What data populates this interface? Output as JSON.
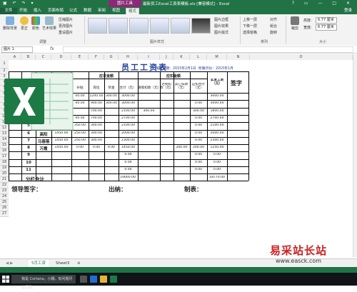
{
  "window": {
    "title": "最新员工Excel工资表模板.xls [兼容模式] - Excel",
    "context_tab": "图片工具",
    "controls": [
      "—",
      "□",
      "✕"
    ]
  },
  "tabs": {
    "file": "文件",
    "items": [
      "开始",
      "插入",
      "页面布局",
      "公式",
      "数据",
      "审阅",
      "视图",
      "格式"
    ],
    "active": "格式",
    "user": "登录"
  },
  "ribbon": {
    "remove_bg": "删除背景",
    "corrections": "更正",
    "color": "颜色",
    "artistic": "艺术效果",
    "compress": "压缩图片",
    "change_pic": "更改图片",
    "reset_pic": "重设图片",
    "group_adjust": "调整",
    "group_styles": "图片样式",
    "border": "图片边框",
    "effects": "图片效果",
    "layout": "图片版式",
    "forward": "上移一层",
    "backward": "下移一层",
    "selection": "选择窗格",
    "align": "对齐",
    "group": "组合",
    "rotate": "旋转",
    "group_arrange": "排列",
    "crop": "裁剪",
    "height_label": "高度:",
    "height_value": "6.77 厘米",
    "width_label": "宽度:",
    "width_value": "6.77 厘米",
    "group_size": "大小"
  },
  "formula_bar": {
    "name_box": "图片 1",
    "fx": "fx",
    "value": ""
  },
  "columns": [
    "A",
    "B",
    "C",
    "D",
    "E",
    "F",
    "G",
    "H",
    "I",
    "J",
    "K",
    "L",
    "M",
    "N",
    "O"
  ],
  "rows": [
    "1",
    "2",
    "3",
    "4",
    "5",
    "6",
    "7",
    "8",
    "9",
    "10",
    "11",
    "12",
    "13",
    "14",
    "15",
    "16",
    "17",
    "18",
    "19",
    "20",
    "21",
    "22",
    "23",
    "24",
    "25",
    "26",
    "27"
  ],
  "sheet": {
    "title": "员工工资表",
    "date_label": "发放日期：2015年2月1日",
    "period_label": "所属月份：2015年1月",
    "band_payable": "应发金额",
    "band_deduct": "应扣金额",
    "headers": {
      "subsidy": "补贴",
      "post": "岗位",
      "bonus": "奖金",
      "total": "合计（元）",
      "leave": "请假扣款（元）",
      "late": "迟到扣款（元）",
      "other": "其它扣款（元）",
      "deduct_total": "应扣合计（元）",
      "actual": "实发工资（元）",
      "sign": "签字"
    },
    "rows": [
      {
        "no": "",
        "name": "",
        "base": "",
        "subsidy": "00.00",
        "post": "1200.00",
        "bonus": "300.00",
        "total": "3000.00",
        "leave": "",
        "late": "",
        "other": "",
        "dtotal": "",
        "actual": "3000.00"
      },
      {
        "no": "",
        "name": "",
        "base": "",
        "subsidy": "00.00",
        "post": "900.00",
        "bonus": "300.00",
        "total": "3000.00",
        "leave": "",
        "late": "",
        "other": "",
        "dtotal": "0.00",
        "actual": "3000.00"
      },
      {
        "no": "",
        "name": "",
        "base": "",
        "subsidy": "",
        "post": "700.00",
        "bonus": "",
        "total": "2100.00",
        "leave": "300.00",
        "late": "",
        "other": "",
        "dtotal": "300.00",
        "actual": "1800.00"
      },
      {
        "no": "",
        "name": "",
        "base": "",
        "subsidy": "00.00",
        "post": "700.00",
        "bonus": "",
        "total": "2700.00",
        "leave": "",
        "late": "",
        "other": "",
        "dtotal": "0.00",
        "actual": "2700.00"
      },
      {
        "no": "5",
        "name": "张曼丽",
        "base": "1450.00",
        "subsidy": "350.00",
        "post": "300.00",
        "bonus": "",
        "total": "2100.00",
        "leave": "",
        "late": "",
        "other": "",
        "dtotal": "0.00",
        "actual": "2100.00"
      },
      {
        "no": "6",
        "name": "高阳",
        "base": "1450.00",
        "subsidy": "250.00",
        "post": "300.00",
        "bonus": "",
        "total": "2000.00",
        "leave": "",
        "late": "",
        "other": "",
        "dtotal": "0.00",
        "actual": "2000.00"
      },
      {
        "no": "7",
        "name": "马蓓蓓",
        "base": "1450.00",
        "subsidy": "250.00",
        "post": "300.00",
        "bonus": "",
        "total": "2300.00",
        "leave": "",
        "late": "",
        "other": "",
        "dtotal": "0.00",
        "actual": "2300.00"
      },
      {
        "no": "8",
        "name": "万霞",
        "base": "1450.00",
        "subsidy": "0.00",
        "post": "0.00",
        "bonus": "0.00",
        "total": "1450.00",
        "leave": "",
        "late": "",
        "other": "200.00",
        "dtotal": "200.00",
        "actual": "1250.00"
      },
      {
        "no": "9",
        "name": "",
        "base": "",
        "subsidy": "",
        "post": "",
        "bonus": "",
        "total": "0.00",
        "leave": "",
        "late": "",
        "other": "",
        "dtotal": "0.00",
        "actual": "0.00"
      },
      {
        "no": "10",
        "name": "",
        "base": "",
        "subsidy": "",
        "post": "",
        "bonus": "",
        "total": "0.00",
        "leave": "",
        "late": "",
        "other": "",
        "dtotal": "0.00",
        "actual": "0.00"
      },
      {
        "no": "11",
        "name": "",
        "base": "",
        "subsidy": "",
        "post": "",
        "bonus": "",
        "total": "0.00",
        "leave": "",
        "late": "",
        "other": "",
        "dtotal": "0.00",
        "actual": "0.00"
      }
    ],
    "total_label": "分栏合计",
    "grand_total": "19000.00",
    "grand_actual": "18770.00",
    "leader_sign": "领导签字：",
    "cashier": "出纳：",
    "preparer": "制表："
  },
  "sheet_tabs": [
    "5月工资",
    "Sheet3"
  ],
  "sheet_tabs_active": "5月工资",
  "taskbar": {
    "search_placeholder": "我是 Cortana，小娜。有问题尽管问我。"
  },
  "watermark": {
    "brand": "易采站长站",
    "url": "www.easck.com"
  },
  "colors": {
    "excel_green": "#217346",
    "title_blue": "#1f3d99",
    "context_tab": "#8a2a76",
    "watermark_red": "#cc1f1f"
  }
}
